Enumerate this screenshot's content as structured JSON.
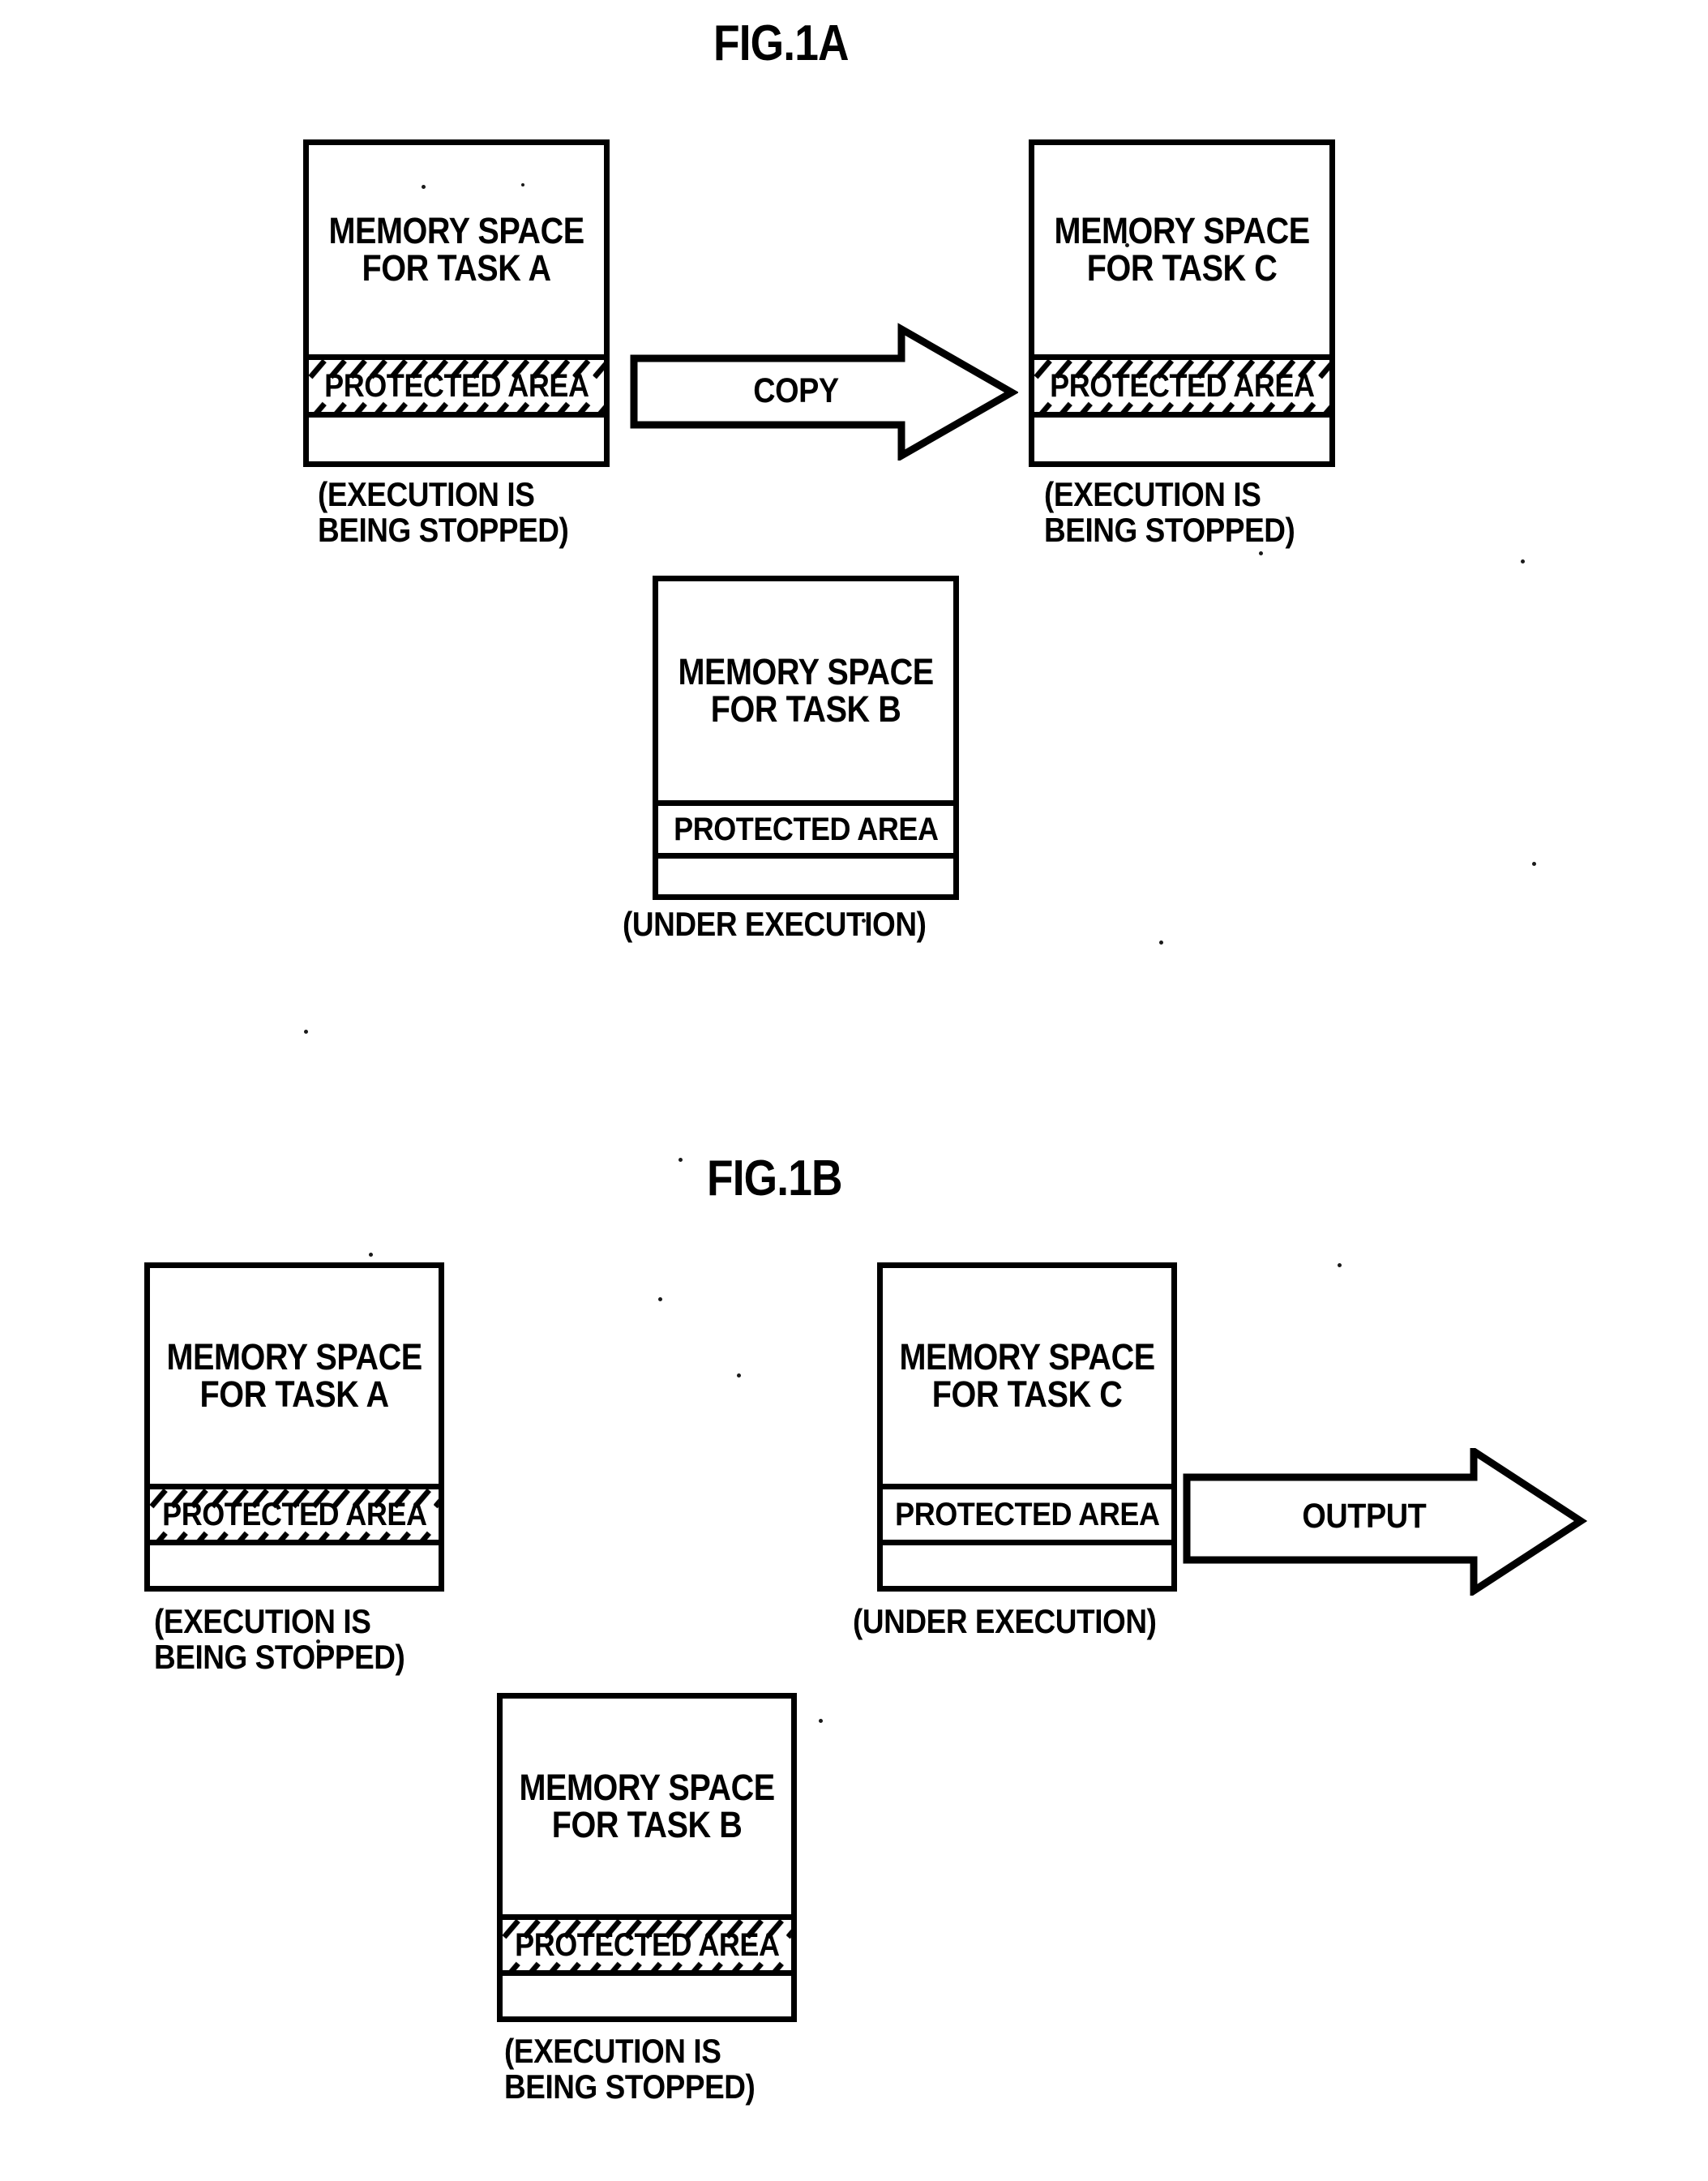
{
  "figures": [
    {
      "id": "fig-1a",
      "title": "FIG.1A",
      "blocks": [
        {
          "name": "task-a",
          "label_line1": "MEMORY SPACE",
          "label_line2": "FOR TASK A",
          "protected_label": "PROTECTED AREA",
          "protected_hatched": true,
          "caption_line1": "(EXECUTION IS",
          "caption_line2": "BEING STOPPED)"
        },
        {
          "name": "task-c",
          "label_line1": "MEMORY SPACE",
          "label_line2": "FOR TASK C",
          "protected_label": "PROTECTED AREA",
          "protected_hatched": true,
          "caption_line1": "(EXECUTION IS",
          "caption_line2": "BEING STOPPED)"
        },
        {
          "name": "task-b",
          "label_line1": "MEMORY SPACE",
          "label_line2": "FOR TASK B",
          "protected_label": "PROTECTED AREA",
          "protected_hatched": false,
          "caption_line1": "(UNDER EXECUTION)",
          "caption_line2": ""
        }
      ],
      "arrow": {
        "name": "copy-arrow",
        "label": "COPY"
      }
    },
    {
      "id": "fig-1b",
      "title": "FIG.1B",
      "blocks": [
        {
          "name": "task-a",
          "label_line1": "MEMORY SPACE",
          "label_line2": "FOR TASK A",
          "protected_label": "PROTECTED AREA",
          "protected_hatched": true,
          "caption_line1": "(EXECUTION IS",
          "caption_line2": "BEING STOPPED)"
        },
        {
          "name": "task-c",
          "label_line1": "MEMORY SPACE",
          "label_line2": "FOR TASK C",
          "protected_label": "PROTECTED AREA",
          "protected_hatched": false,
          "caption_line1": "(UNDER EXECUTION)",
          "caption_line2": ""
        },
        {
          "name": "task-b",
          "label_line1": "MEMORY SPACE",
          "label_line2": "FOR TASK B",
          "protected_label": "PROTECTED AREA",
          "protected_hatched": true,
          "caption_line1": "(EXECUTION IS",
          "caption_line2": "BEING STOPPED)"
        }
      ],
      "arrow": {
        "name": "output-arrow",
        "label": "OUTPUT"
      }
    }
  ],
  "colors": {
    "ink": "#000000",
    "paper": "#ffffff"
  }
}
